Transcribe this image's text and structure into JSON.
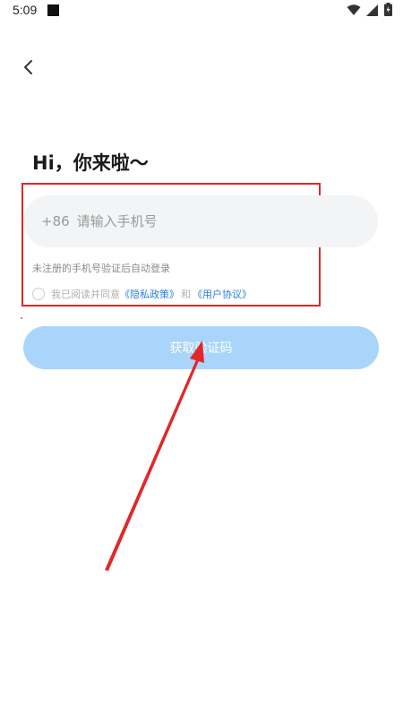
{
  "status_bar": {
    "time": "5:09"
  },
  "header": {
    "greeting": "Hi，你来啦～"
  },
  "login": {
    "country_code": "+86",
    "phone_placeholder": "请输入手机号",
    "hint": "未注册的手机号验证后自动登录",
    "agreement": {
      "prefix": "我已阅读并同意",
      "privacy_link": "《隐私政策》",
      "conjunction": "和",
      "user_agreement_link": "《用户协议》",
      "checked": false
    },
    "get_code_label": "获取验证码"
  },
  "colors": {
    "primary_disabled": "#a9d5fa",
    "link": "#2a7de1",
    "annotation": "#e0282a",
    "input_background": "#f3f4f6"
  },
  "icons": {
    "back": "chevron-left-icon",
    "wifi": "wifi-icon",
    "signal": "cell-signal-icon",
    "battery": "battery-icon"
  }
}
